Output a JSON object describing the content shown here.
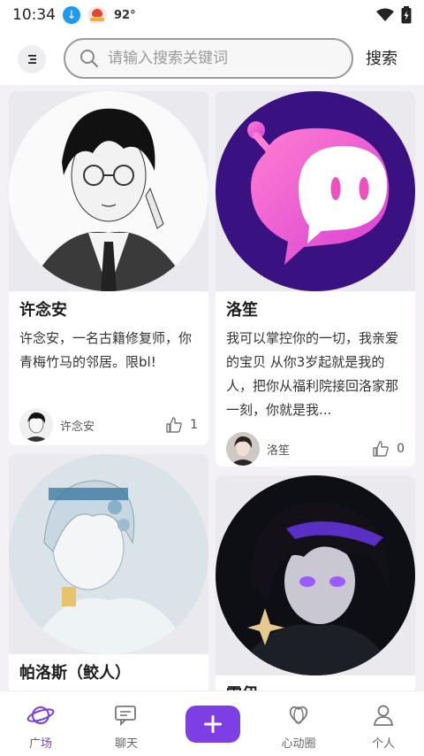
{
  "status_bar": {
    "time": "10:34",
    "temperature": "92°"
  },
  "search": {
    "placeholder": "请输入搜索关键词",
    "button_label": "搜索"
  },
  "cards": [
    {
      "title": "许念安",
      "description": "许念安，一名古籍修复师，你青梅竹马的邻居。限bl!",
      "author": "许念安",
      "likes": "1"
    },
    {
      "title": "洛笙",
      "description": "我可以掌控你的一切，我亲爱的宝贝 从你3岁起就是我的人，把你从福利院接回洛家那一刻，你就是我...",
      "author": "洛笙",
      "likes": "0"
    },
    {
      "title": "帕洛斯（鲛人）"
    },
    {
      "title": "雷伊"
    }
  ],
  "bottom_nav": [
    {
      "label": "广场",
      "icon": "planet-icon"
    },
    {
      "label": "聊天",
      "icon": "chat-icon"
    },
    {
      "label": "",
      "icon": "plus-icon"
    },
    {
      "label": "心动圈",
      "icon": "heart-circle-icon"
    },
    {
      "label": "个人",
      "icon": "person-icon"
    }
  ],
  "colors": {
    "accent": "#7d3ee3",
    "background": "#f3f1f5"
  }
}
